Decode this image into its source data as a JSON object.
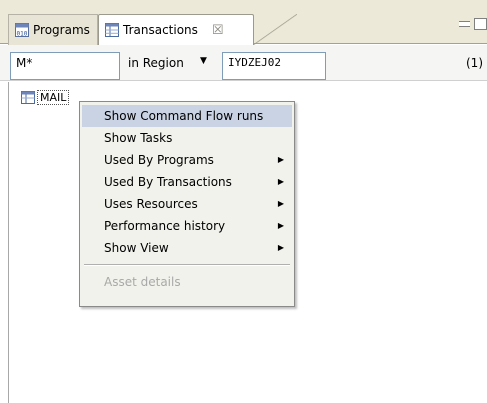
{
  "tabs": [
    {
      "label": "Programs",
      "icon": "program-icon",
      "active": false
    },
    {
      "label": "Transactions",
      "icon": "table-icon",
      "active": true,
      "close": "☒"
    }
  ],
  "filter": {
    "mask_value": "M*",
    "region_label": "in Region",
    "region_caret": "▼",
    "region_value": "IYDZEJ02",
    "count": "(1)"
  },
  "list": {
    "items": [
      {
        "label": "MAIL",
        "icon": "table-icon"
      }
    ]
  },
  "menu": {
    "items": [
      {
        "label": "Show Command Flow runs",
        "highlighted": true,
        "submenu": false,
        "enabled": true
      },
      {
        "label": "Show Tasks",
        "submenu": false,
        "enabled": true
      },
      {
        "label": "Used By Programs",
        "submenu": true,
        "enabled": true
      },
      {
        "label": "Used By Transactions",
        "submenu": true,
        "enabled": true
      },
      {
        "label": "Uses Resources",
        "submenu": true,
        "enabled": true
      },
      {
        "label": "Performance history",
        "submenu": true,
        "enabled": true
      },
      {
        "label": "Show View",
        "submenu": true,
        "enabled": true
      }
    ],
    "footer_item": {
      "label": "Asset details",
      "enabled": false
    },
    "submenu_arrow": "▶"
  },
  "colors": {
    "highlight": "#c9d3e3",
    "tab_bar": "#ece9d8",
    "field_border": "#7f9db9"
  }
}
